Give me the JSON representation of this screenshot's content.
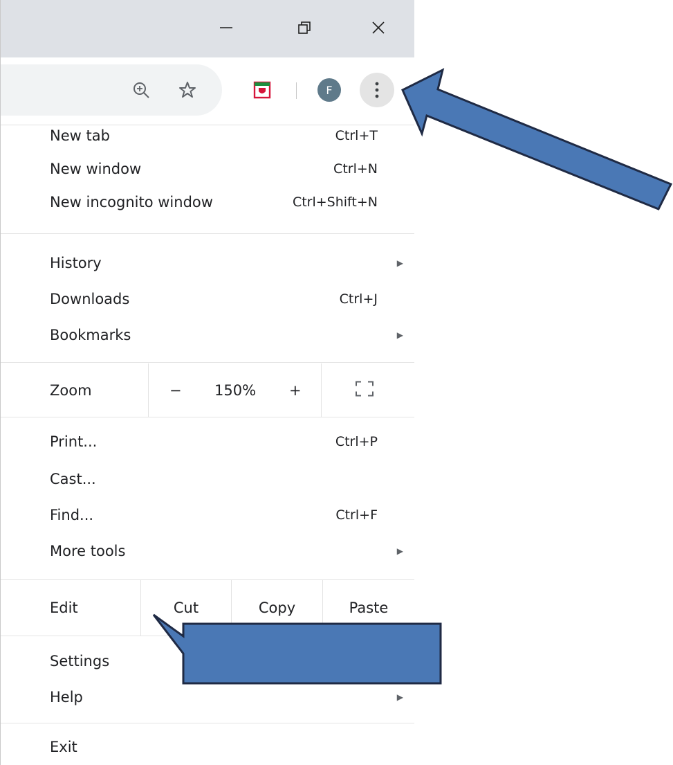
{
  "window_controls": {
    "minimize_icon": "minimize-icon",
    "restore_icon": "restore-icon",
    "close_icon": "close-icon"
  },
  "toolbar": {
    "zoom_icon": "zoom-magnifier-icon",
    "bookmark_icon": "star-icon",
    "extension_icon": "extension-shield-icon",
    "avatar_letter": "F",
    "menu_icon": "three-dots-vertical-icon"
  },
  "menu": {
    "new_tab": {
      "label": "New tab",
      "shortcut": "Ctrl+T"
    },
    "new_window": {
      "label": "New window",
      "shortcut": "Ctrl+N"
    },
    "new_incognito": {
      "label": "New incognito window",
      "shortcut": "Ctrl+Shift+N"
    },
    "history": {
      "label": "History"
    },
    "downloads": {
      "label": "Downloads",
      "shortcut": "Ctrl+J"
    },
    "bookmarks": {
      "label": "Bookmarks"
    },
    "zoom": {
      "label": "Zoom",
      "minus": "−",
      "value": "150%",
      "plus": "+"
    },
    "print": {
      "label": "Print...",
      "shortcut": "Ctrl+P"
    },
    "cast": {
      "label": "Cast..."
    },
    "find": {
      "label": "Find...",
      "shortcut": "Ctrl+F"
    },
    "more_tools": {
      "label": "More tools"
    },
    "edit": {
      "label": "Edit",
      "cut": "Cut",
      "copy": "Copy",
      "paste": "Paste"
    },
    "settings": {
      "label": "Settings"
    },
    "help": {
      "label": "Help"
    },
    "exit": {
      "label": "Exit"
    }
  },
  "colors": {
    "titlebar": "#dee1e6",
    "arrow_fill": "#4a78b5",
    "arrow_stroke": "#1f2a44",
    "avatar": "#5f7a8a"
  }
}
